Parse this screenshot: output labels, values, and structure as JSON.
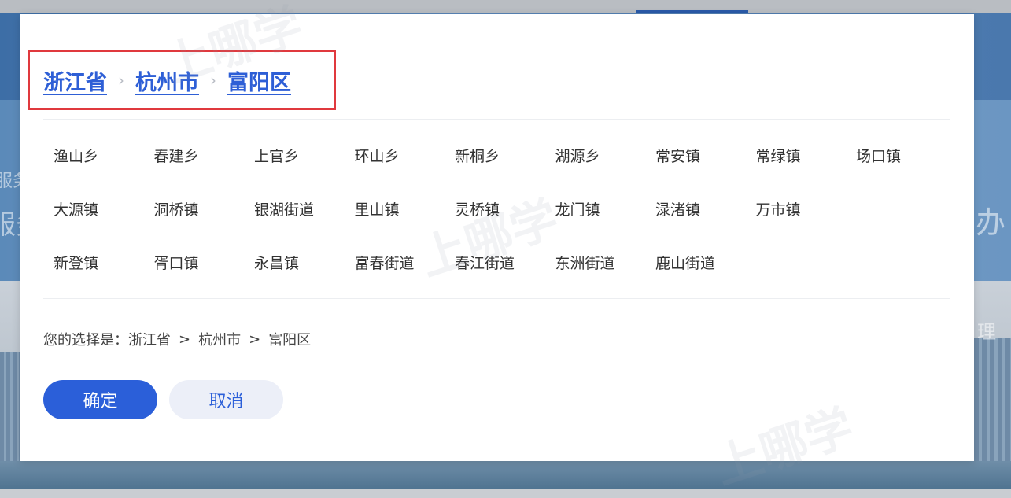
{
  "background": {
    "glyphs": [
      "服务",
      "服务",
      "办",
      "理"
    ]
  },
  "breadcrumb": {
    "items": [
      {
        "label": "浙江省"
      },
      {
        "label": "杭州市"
      },
      {
        "label": "富阳区"
      }
    ],
    "separator": "›"
  },
  "towns": {
    "rows": [
      [
        "渔山乡",
        "春建乡",
        "上官乡",
        "环山乡",
        "新桐乡",
        "湖源乡",
        "常安镇",
        "常绿镇",
        "场口镇"
      ],
      [
        "大源镇",
        "洞桥镇",
        "银湖街道",
        "里山镇",
        "灵桥镇",
        "龙门镇",
        "渌渚镇",
        "万市镇"
      ],
      [
        "新登镇",
        "胥口镇",
        "永昌镇",
        "富春街道",
        "春江街道",
        "东洲街道",
        "鹿山街道"
      ]
    ]
  },
  "selection": {
    "label": "您的选择是：",
    "province": "浙江省",
    "city": "杭州市",
    "district": "富阳区",
    "separator": ">"
  },
  "buttons": {
    "confirm": "确定",
    "cancel": "取消"
  },
  "watermark": "上哪学",
  "colors": {
    "accent": "#2b5fd9",
    "highlight_border": "#e0393e",
    "text": "#333333"
  }
}
